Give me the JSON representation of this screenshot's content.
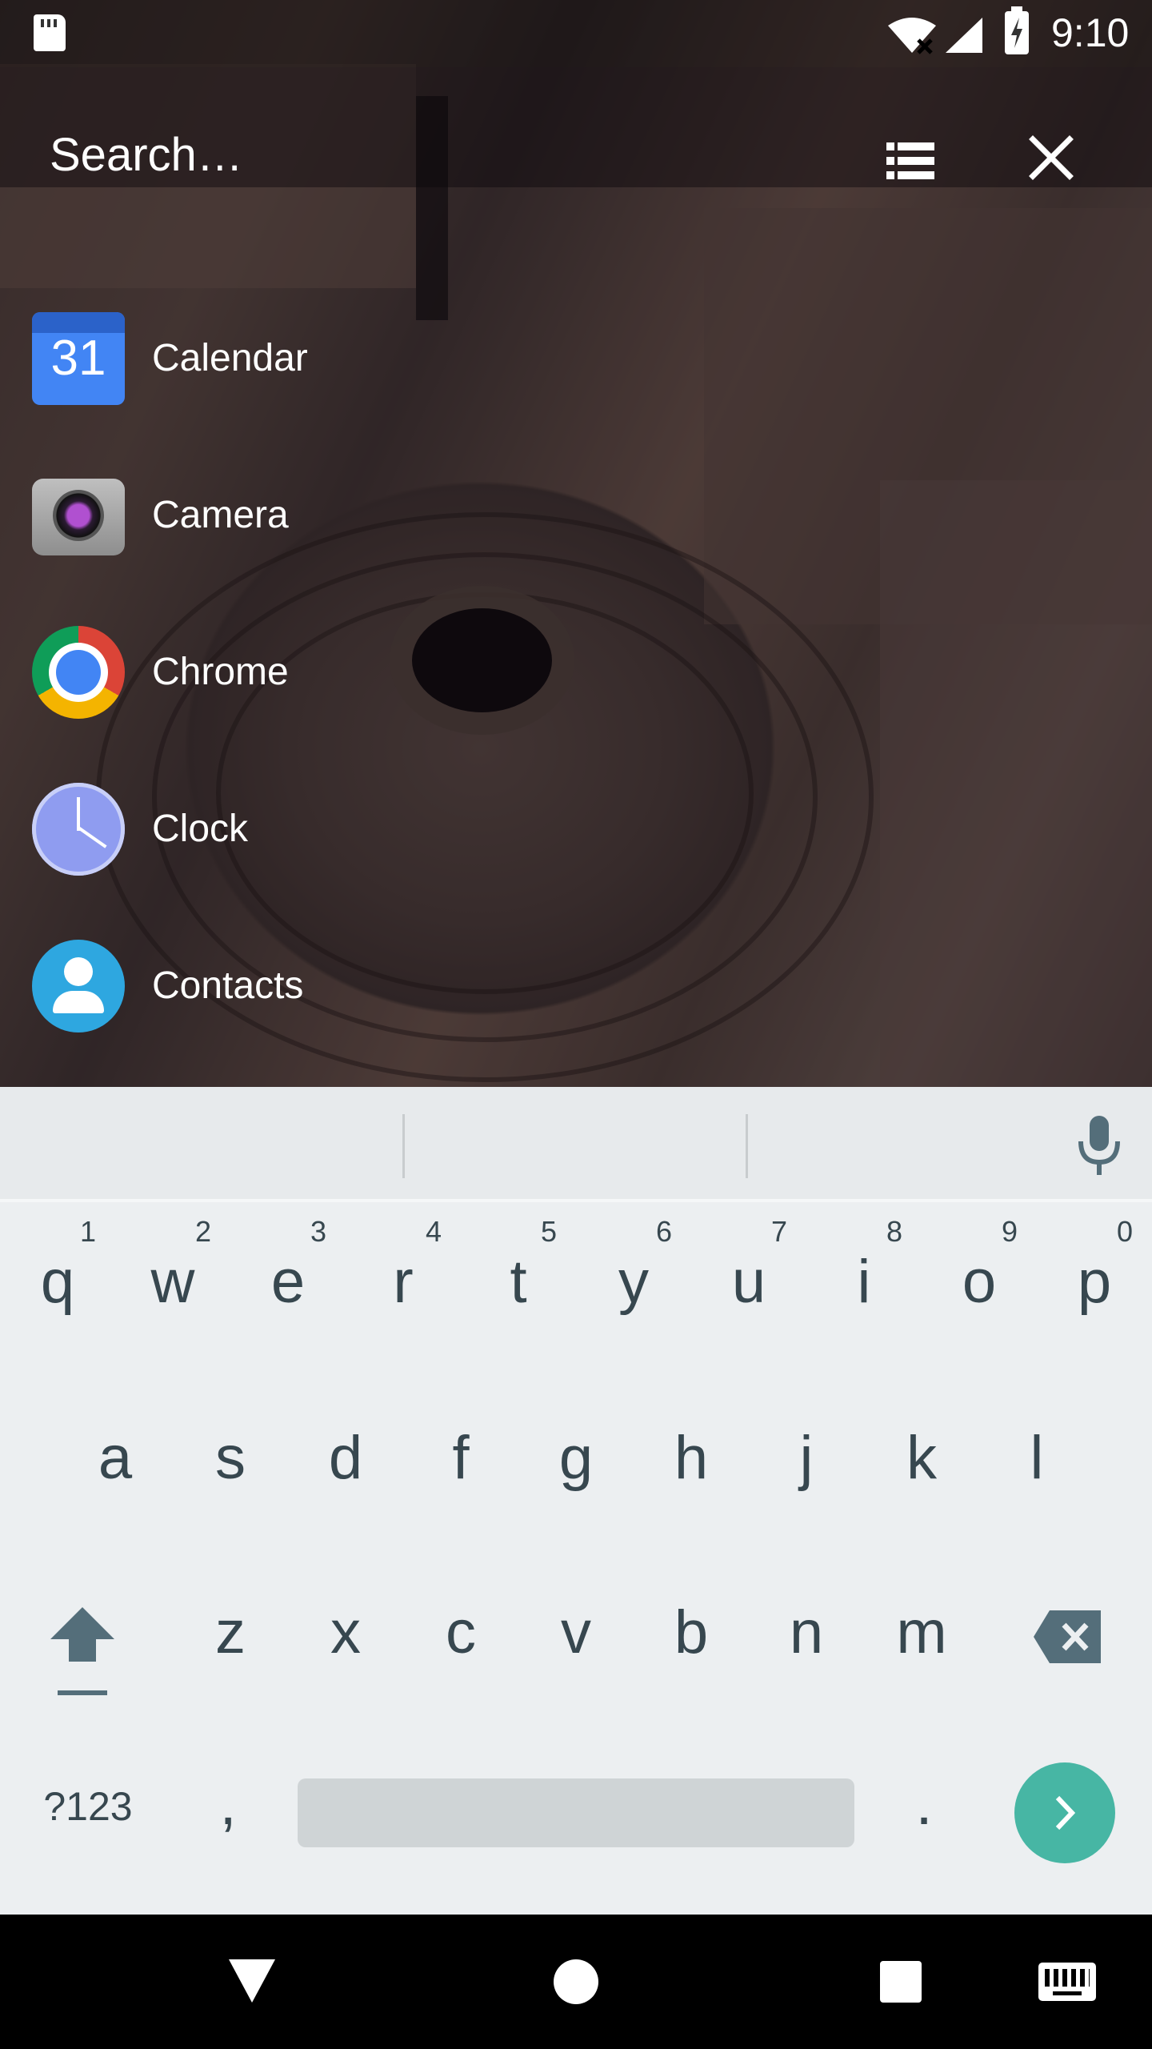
{
  "status_bar": {
    "time": "9:10",
    "icons": [
      "sd-card-icon",
      "wifi-icon",
      "signal-icon",
      "battery-charging-icon"
    ]
  },
  "search": {
    "placeholder": "Search…",
    "list_view_icon": "list-view-icon",
    "close_icon": "close-icon"
  },
  "apps": [
    {
      "label": "Calendar",
      "icon": "calendar-icon",
      "icon_text": "31"
    },
    {
      "label": "Camera",
      "icon": "camera-icon"
    },
    {
      "label": "Chrome",
      "icon": "chrome-icon"
    },
    {
      "label": "Clock",
      "icon": "clock-icon"
    },
    {
      "label": "Contacts",
      "icon": "contacts-icon"
    }
  ],
  "keyboard": {
    "row1": [
      "q",
      "w",
      "e",
      "r",
      "t",
      "y",
      "u",
      "i",
      "o",
      "p"
    ],
    "row1_hints": [
      "1",
      "2",
      "3",
      "4",
      "5",
      "6",
      "7",
      "8",
      "9",
      "0"
    ],
    "row2": [
      "a",
      "s",
      "d",
      "f",
      "g",
      "h",
      "j",
      "k",
      "l"
    ],
    "row3": [
      "z",
      "x",
      "c",
      "v",
      "b",
      "n",
      "m"
    ],
    "symbols_label": "?123",
    "comma": ",",
    "period": ".",
    "accent_color": "#47b6a4"
  },
  "nav_bar": {
    "icons": [
      "back-icon",
      "home-icon",
      "recents-icon",
      "keyboard-switch-icon"
    ]
  }
}
